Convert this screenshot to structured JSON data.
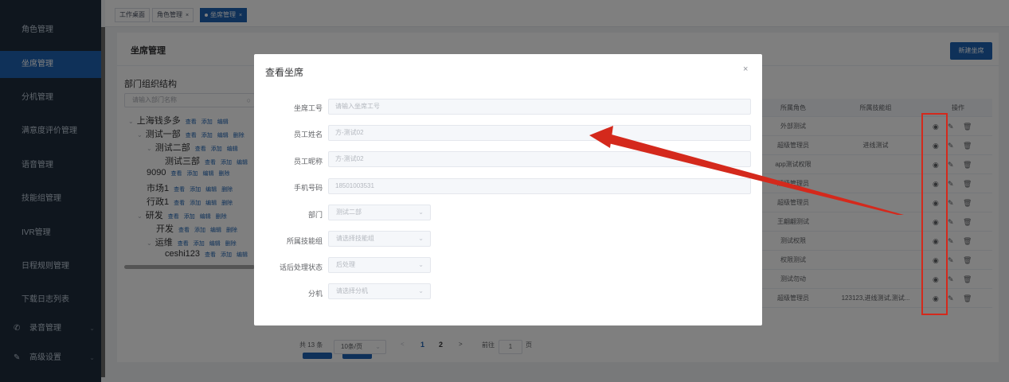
{
  "sidebar": {
    "items": [
      {
        "label": "角色管理"
      },
      {
        "label": "坐席管理"
      },
      {
        "label": "分机管理"
      },
      {
        "label": "满意度评价管理"
      },
      {
        "label": "语音管理"
      },
      {
        "label": "技能组管理"
      },
      {
        "label": "IVR管理"
      },
      {
        "label": "日程规则管理"
      },
      {
        "label": "下载日志列表"
      },
      {
        "label": "录音管理",
        "icon": "phone-icon"
      },
      {
        "label": "高级设置",
        "icon": "pen-icon"
      }
    ],
    "active_index": 1
  },
  "tabs": [
    {
      "label": "工作桌面"
    },
    {
      "label": "角色管理"
    },
    {
      "label": "坐席管理"
    }
  ],
  "page": {
    "title": "坐席管理",
    "new_button": "新建坐席",
    "tree_title": "部门组织结构",
    "tree_search_placeholder": "请输入部门名称"
  },
  "tree": {
    "actions": {
      "view": "查看",
      "add": "添加",
      "edit": "编辑",
      "delete": "删除"
    },
    "nodes": [
      {
        "label": "上海钱多多",
        "expanded": true
      },
      {
        "label": "测试一部",
        "expanded": true
      },
      {
        "label": "测试二部",
        "expanded": true
      },
      {
        "label": "测试三部"
      },
      {
        "label": "9090"
      },
      {
        "label": "市场1"
      },
      {
        "label": "行政1"
      },
      {
        "label": "研发",
        "expanded": true
      },
      {
        "label": "开发"
      },
      {
        "label": "运维",
        "expanded": true
      },
      {
        "label": "ceshi123"
      }
    ]
  },
  "table": {
    "headers": [
      "所属角色",
      "所属技能组",
      "操作"
    ],
    "rows": [
      {
        "role": "外部测试",
        "group": ""
      },
      {
        "role": "超级管理员",
        "group": "进线测试"
      },
      {
        "role": "app测试权限",
        "group": ""
      },
      {
        "role": "超级管理员",
        "group": ""
      },
      {
        "role": "超级管理员",
        "group": ""
      },
      {
        "role": "王翩翩测试",
        "group": ""
      },
      {
        "role": "测试权限",
        "group": ""
      },
      {
        "role": "权限测试",
        "group": ""
      },
      {
        "role": "测试勿动",
        "group": ""
      },
      {
        "role": "超级管理员",
        "group": "123123,进线测试,测试..."
      }
    ],
    "op_icons": [
      "eye-icon",
      "edit-icon",
      "trash-icon"
    ]
  },
  "pagination": {
    "total": "共 13 条",
    "page_size": "10条/页",
    "pages": [
      "1",
      "2"
    ],
    "current": "1",
    "goto_label": "前往",
    "goto_value": "1",
    "page_suffix": "页"
  },
  "dialog": {
    "title": "查看坐席",
    "fields": {
      "agent_id": {
        "label": "坐席工号",
        "placeholder": "请输入坐席工号"
      },
      "name": {
        "label": "员工姓名",
        "value": "方-测试02"
      },
      "nickname": {
        "label": "员工昵称",
        "value": "方-测试02"
      },
      "phone": {
        "label": "手机号码",
        "value": "18501003531"
      },
      "dept": {
        "label": "部门",
        "value": "测试二部"
      },
      "skill_group": {
        "label": "所属技能组",
        "placeholder": "请选择技能组"
      },
      "after_call": {
        "label": "话后处理状态",
        "value": "后处理"
      },
      "extension": {
        "label": "分机",
        "placeholder": "请选择分机"
      }
    }
  },
  "colors": {
    "sidebar_bg": "#1f2d3d",
    "accent": "#1e63b3",
    "annotation_red": "#d4291c"
  }
}
